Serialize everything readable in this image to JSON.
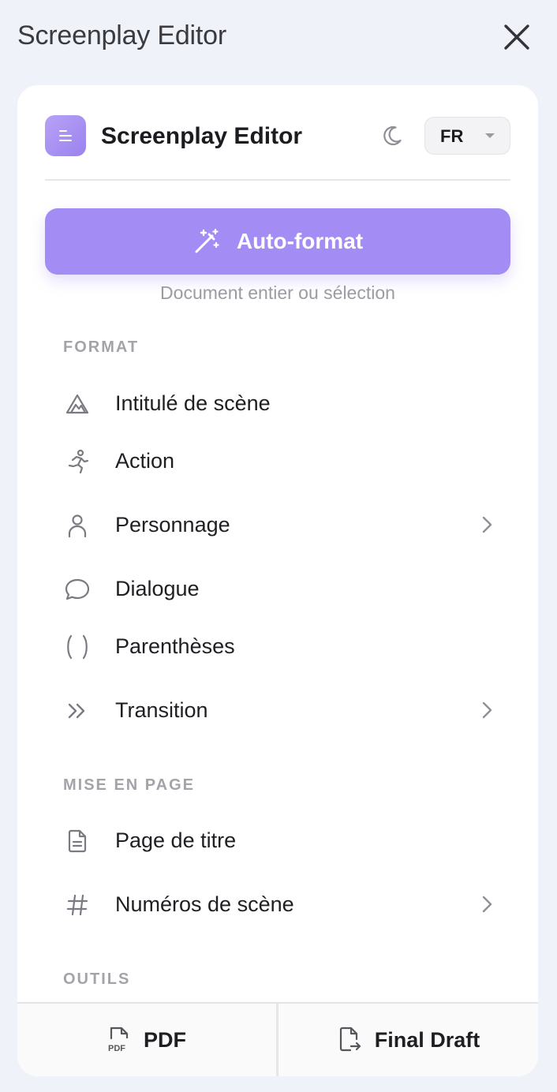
{
  "window": {
    "title": "Screenplay Editor",
    "close_icon": "close-icon"
  },
  "header": {
    "app_name": "Screenplay Editor",
    "logo_icon": "document-lines-icon",
    "theme_icon": "moon-icon",
    "language": "FR"
  },
  "autoformat": {
    "label": "Auto-format",
    "icon": "magic-wand-icon",
    "hint": "Document entier ou sélection"
  },
  "sections": {
    "format": {
      "title": "FORMAT",
      "items": [
        {
          "label": "Intitulé de scène",
          "icon": "mountain-icon",
          "has_submenu": false
        },
        {
          "label": "Action",
          "icon": "running-icon",
          "has_submenu": false
        },
        {
          "label": "Personnage",
          "icon": "person-icon",
          "has_submenu": true
        },
        {
          "label": "Dialogue",
          "icon": "speech-bubble-icon",
          "has_submenu": false
        },
        {
          "label": "Parenthèses",
          "icon": "parentheses-icon",
          "has_submenu": false
        },
        {
          "label": "Transition",
          "icon": "double-chevron-right-icon",
          "has_submenu": true
        }
      ]
    },
    "layout": {
      "title": "MISE EN PAGE",
      "items": [
        {
          "label": "Page de titre",
          "icon": "document-icon",
          "has_submenu": false
        },
        {
          "label": "Numéros de scène",
          "icon": "hash-icon",
          "has_submenu": true
        }
      ]
    },
    "tools": {
      "title": "OUTILS"
    }
  },
  "footer": {
    "pdf_label": "PDF",
    "pdf_icon_text": "PDF",
    "final_draft_label": "Final Draft",
    "final_draft_icon": "file-export-icon"
  },
  "colors": {
    "accent": "#a38cf3",
    "background": "#eff2f8",
    "card": "#ffffff",
    "muted_text": "#9b9ba2"
  }
}
